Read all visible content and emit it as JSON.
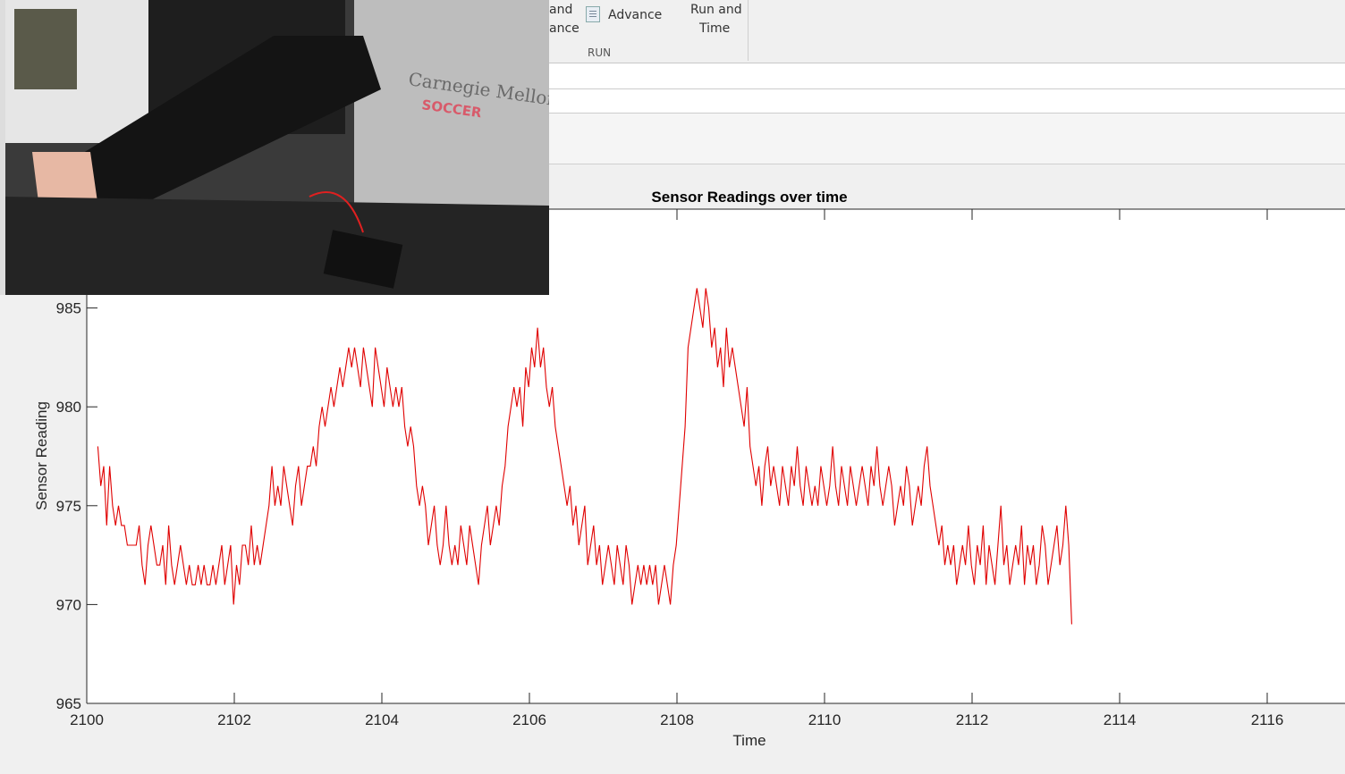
{
  "toolbar": {
    "partial_label_1a": "and",
    "partial_label_1b": "ance",
    "advance_label": "Advance",
    "run_time_line1": "Run and",
    "run_time_line2": "Time",
    "section_label": "RUN"
  },
  "webcam": {
    "shirt_text_1": "Carnegie Mellon",
    "shirt_text_2": "SOCCER"
  },
  "colors": {
    "line": "#e00000",
    "axis": "#262626",
    "figure_bg": "#f0f0f0",
    "plot_bg": "#ffffff"
  },
  "chart_data": {
    "type": "line",
    "title": "Sensor Readings over time",
    "xlabel": "Time",
    "ylabel": "Sensor Reading",
    "xlim": [
      2100,
      2117
    ],
    "ylim": [
      965,
      990
    ],
    "xticks": [
      2100,
      2102,
      2104,
      2106,
      2108,
      2110,
      2112,
      2114,
      2116
    ],
    "yticks": [
      965,
      970,
      975,
      980,
      985
    ],
    "grid": false,
    "series": [
      {
        "name": "",
        "color": "#e00000",
        "step": 0.04,
        "x_start": 2100.15,
        "values": [
          978,
          976,
          977,
          974,
          977,
          975,
          974,
          975,
          974,
          974,
          973,
          973,
          973,
          973,
          974,
          972,
          971,
          973,
          974,
          973,
          972,
          972,
          973,
          971,
          974,
          972,
          971,
          972,
          973,
          972,
          971,
          972,
          971,
          971,
          972,
          971,
          972,
          971,
          971,
          972,
          971,
          972,
          973,
          971,
          972,
          973,
          970,
          972,
          971,
          973,
          973,
          972,
          974,
          972,
          973,
          972,
          973,
          974,
          975,
          977,
          975,
          976,
          975,
          977,
          976,
          975,
          974,
          976,
          977,
          975,
          976,
          977,
          977,
          978,
          977,
          979,
          980,
          979,
          980,
          981,
          980,
          981,
          982,
          981,
          982,
          983,
          982,
          983,
          982,
          981,
          983,
          982,
          981,
          980,
          983,
          982,
          981,
          980,
          982,
          981,
          980,
          981,
          980,
          981,
          979,
          978,
          979,
          978,
          976,
          975,
          976,
          975,
          973,
          974,
          975,
          973,
          972,
          973,
          975,
          973,
          972,
          973,
          972,
          974,
          973,
          972,
          974,
          973,
          972,
          971,
          973,
          974,
          975,
          973,
          974,
          975,
          974,
          976,
          977,
          979,
          980,
          981,
          980,
          981,
          979,
          982,
          981,
          983,
          982,
          984,
          982,
          983,
          981,
          980,
          981,
          979,
          978,
          977,
          976,
          975,
          976,
          974,
          975,
          973,
          974,
          975,
          972,
          973,
          974,
          972,
          973,
          971,
          972,
          973,
          972,
          971,
          973,
          972,
          971,
          973,
          972,
          970,
          971,
          972,
          971,
          972,
          971,
          972,
          971,
          972,
          970,
          971,
          972,
          971,
          970,
          972,
          973,
          975,
          977,
          979,
          983,
          984,
          985,
          986,
          985,
          984,
          986,
          985,
          983,
          984,
          982,
          983,
          981,
          984,
          982,
          983,
          982,
          981,
          980,
          979,
          981,
          978,
          977,
          976,
          977,
          975,
          977,
          978,
          976,
          977,
          976,
          975,
          977,
          976,
          975,
          977,
          976,
          978,
          976,
          975,
          977,
          976,
          975,
          976,
          975,
          977,
          976,
          975,
          976,
          978,
          976,
          975,
          977,
          976,
          975,
          977,
          976,
          975,
          976,
          977,
          976,
          975,
          977,
          976,
          978,
          976,
          975,
          976,
          977,
          976,
          974,
          975,
          976,
          975,
          977,
          976,
          974,
          975,
          976,
          975,
          977,
          978,
          976,
          975,
          974,
          973,
          974,
          972,
          973,
          972,
          973,
          971,
          972,
          973,
          972,
          974,
          972,
          971,
          973,
          972,
          974,
          971,
          973,
          972,
          971,
          973,
          975,
          972,
          973,
          971,
          972,
          973,
          972,
          974,
          971,
          973,
          972,
          973,
          971,
          972,
          974,
          973,
          971,
          972,
          973,
          974,
          972,
          973,
          975,
          973,
          969
        ]
      }
    ]
  }
}
